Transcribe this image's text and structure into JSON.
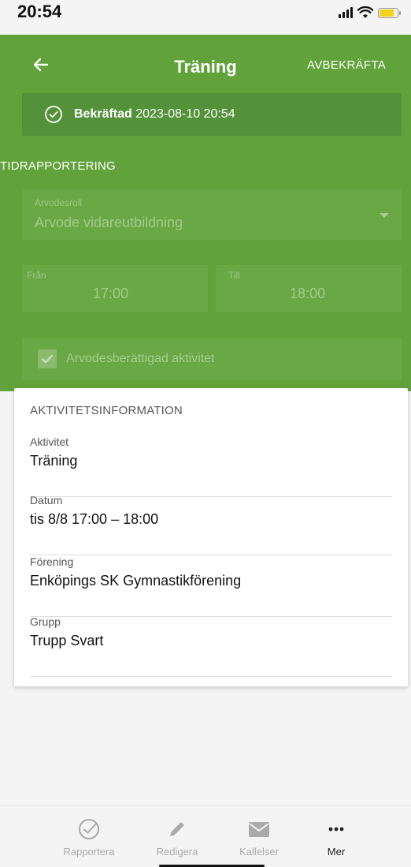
{
  "status_bar": {
    "time": "20:54"
  },
  "header": {
    "title": "Träning",
    "action_label": "AVBEKRÄFTA"
  },
  "banner": {
    "status_label": "Bekräftad",
    "timestamp": "2023-08-10 20:54"
  },
  "time_report": {
    "section_title": "TIDRAPPORTERING",
    "role": {
      "label": "Arvodesroll",
      "value": "Arvode vidareutbildning"
    },
    "from": {
      "label": "Från",
      "value": "17:00"
    },
    "to": {
      "label": "Till",
      "value": "18:00"
    },
    "eligible": {
      "label": "Arvodesberättigad aktivitet",
      "checked": true
    }
  },
  "activity_info": {
    "title": "AKTIVITETSINFORMATION",
    "rows": [
      {
        "label": "Aktivitet",
        "value": "Träning"
      },
      {
        "label": "Datum",
        "value": "tis 8/8 17:00 – 18:00"
      },
      {
        "label": "Förening",
        "value": "Enköpings SK Gymnastikförening"
      },
      {
        "label": "Grupp",
        "value": "Trupp Svart"
      }
    ]
  },
  "bottom_nav": {
    "items": [
      {
        "label": "Rapportera",
        "icon": "check-circle-icon",
        "active": false
      },
      {
        "label": "Redigera",
        "icon": "pencil-icon",
        "active": false
      },
      {
        "label": "Kallelser",
        "icon": "mail-icon",
        "active": false
      },
      {
        "label": "Mer",
        "icon": "more-dots-icon",
        "active": true
      }
    ]
  },
  "colors": {
    "primary_green": "#61a33a",
    "banner_green": "#54923a",
    "battery_yellow": "#f2d21b"
  }
}
